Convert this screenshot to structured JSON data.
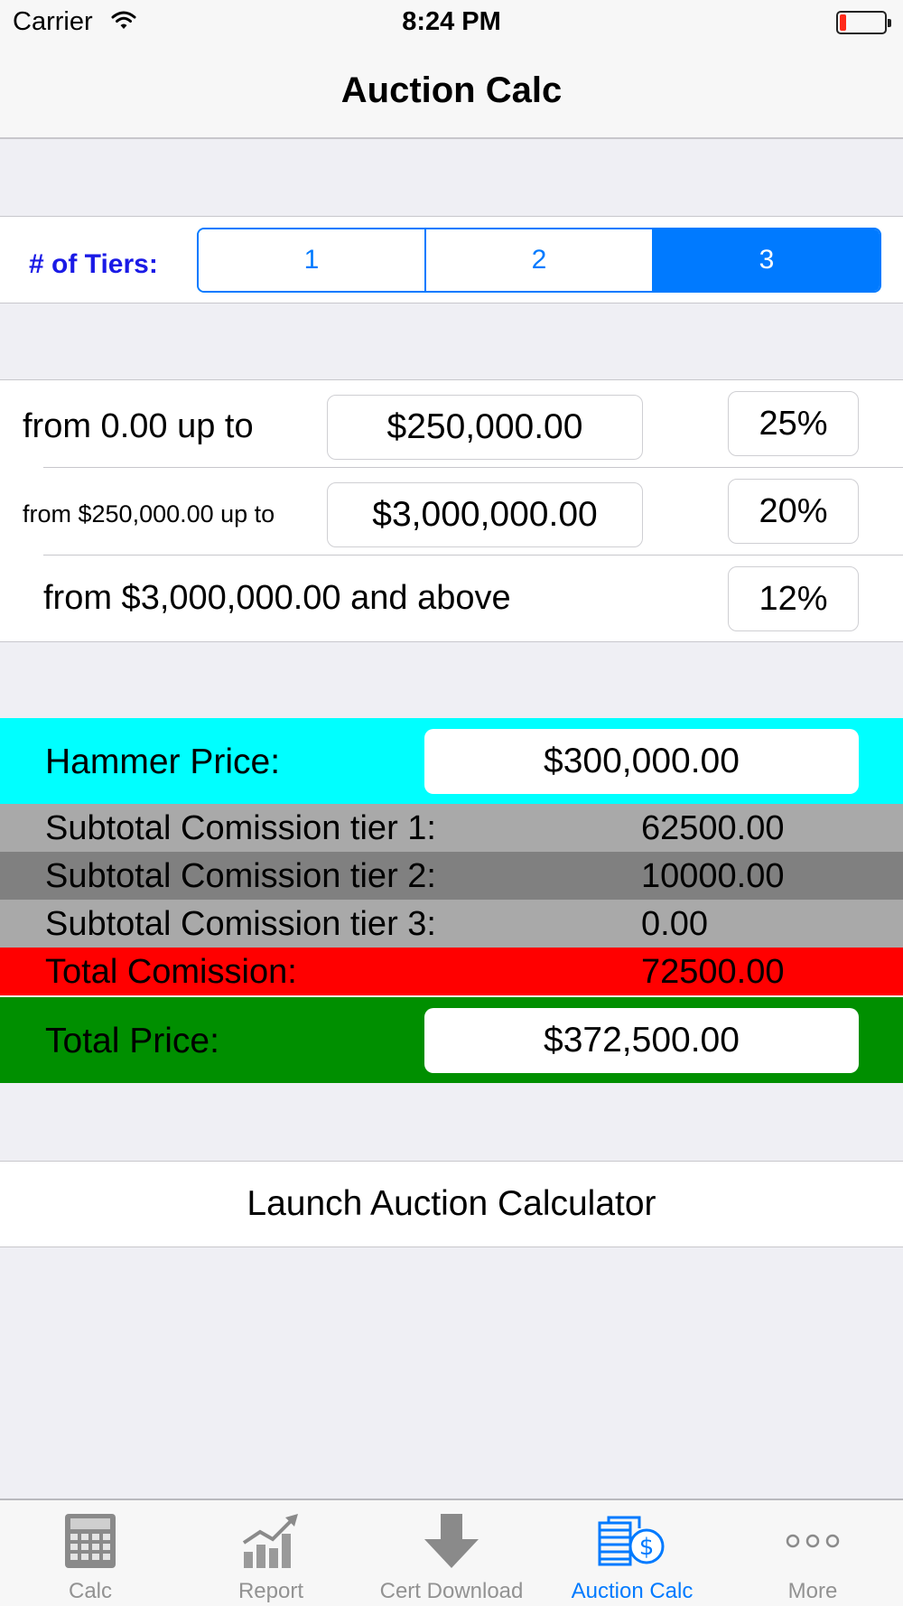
{
  "status_bar": {
    "carrier": "Carrier",
    "time": "8:24 PM"
  },
  "nav": {
    "title": "Auction Calc"
  },
  "tiers": {
    "label": "# of Tiers:",
    "options": [
      "1",
      "2",
      "3"
    ],
    "selected": "3"
  },
  "tier_rows": [
    {
      "label": "from 0.00 up to",
      "limit": "$250,000.00",
      "rate": "25%"
    },
    {
      "label": "from $250,000.00 up to",
      "limit": "$3,000,000.00",
      "rate": "20%"
    },
    {
      "label": "from $3,000,000.00 and above",
      "rate": "12%"
    }
  ],
  "results": {
    "hammer_label": "Hammer Price:",
    "hammer_value": "$300,000.00",
    "subtotal1_label": "Subtotal Comission tier 1:",
    "subtotal1_value": "62500.00",
    "subtotal2_label": "Subtotal Comission tier 2:",
    "subtotal2_value": "10000.00",
    "subtotal3_label": "Subtotal Comission tier 3:",
    "subtotal3_value": "0.00",
    "total_commission_label": "Total Comission:",
    "total_commission_value": "72500.00",
    "total_price_label": "Total Price:",
    "total_price_value": "$372,500.00"
  },
  "colors": {
    "hammer_bg": "#00ffff",
    "subtotal_light_bg": "#a9a9a9",
    "subtotal_dark_bg": "#808080",
    "total_commission_bg": "#ff0000",
    "total_price_bg": "#008f00",
    "accent": "#007aff"
  },
  "launch_button": "Launch Auction Calculator",
  "tab_bar": [
    {
      "label": "Calc",
      "icon": "calculator-icon",
      "active": false
    },
    {
      "label": "Report",
      "icon": "chart-icon",
      "active": false
    },
    {
      "label": "Cert Download",
      "icon": "download-arrow-icon",
      "active": false
    },
    {
      "label": "Auction Calc",
      "icon": "auction-money-icon",
      "active": true
    },
    {
      "label": "More",
      "icon": "more-dots-icon",
      "active": false
    }
  ]
}
